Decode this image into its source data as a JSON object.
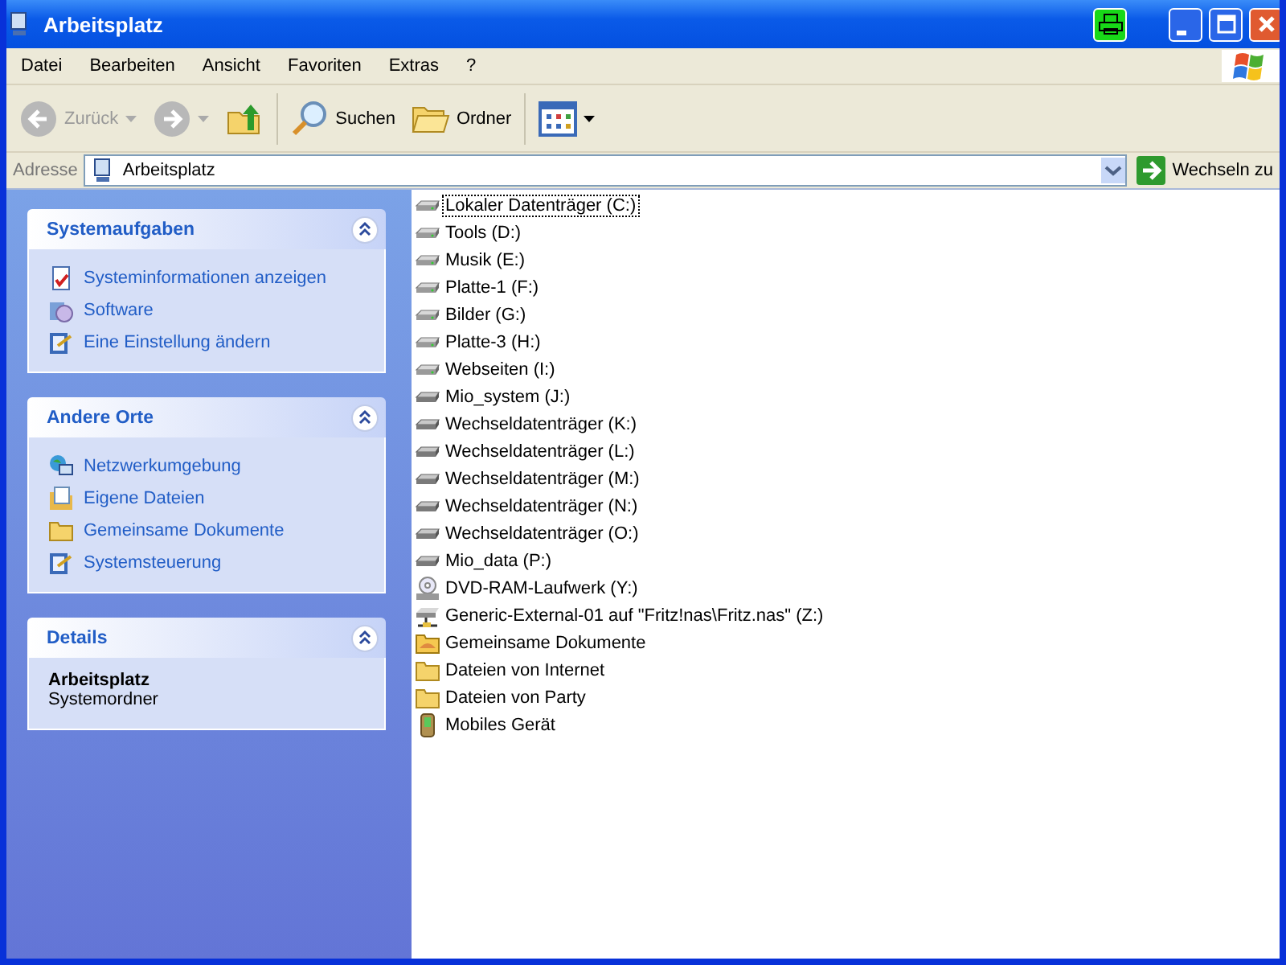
{
  "window": {
    "title": "Arbeitsplatz"
  },
  "menu": [
    "Datei",
    "Bearbeiten",
    "Ansicht",
    "Favoriten",
    "Extras",
    "?"
  ],
  "toolbar": [
    {
      "kind": "back",
      "label": "Zurück",
      "disabled": true
    },
    {
      "kind": "forward",
      "disabled": true
    },
    {
      "kind": "up"
    },
    {
      "kind": "separator"
    },
    {
      "kind": "search",
      "label": "Suchen"
    },
    {
      "kind": "folders",
      "label": "Ordner"
    },
    {
      "kind": "separator"
    },
    {
      "kind": "views"
    }
  ],
  "address": {
    "label": "Adresse",
    "value": "Arbeitsplatz",
    "go": "Wechseln zu"
  },
  "panels": [
    {
      "title": "Systemaufgaben",
      "expanded": true,
      "links": [
        {
          "kind": "info",
          "label": "Systeminformationen anzeigen"
        },
        {
          "kind": "software",
          "label": "Software"
        },
        {
          "kind": "control",
          "label": "Eine Einstellung ändern"
        }
      ]
    },
    {
      "title": "Andere Orte",
      "expanded": true,
      "links": [
        {
          "kind": "network",
          "label": "Netzwerkumgebung"
        },
        {
          "kind": "documents",
          "label": "Eigene Dateien"
        },
        {
          "kind": "folder",
          "label": "Gemeinsame Dokumente"
        },
        {
          "kind": "control",
          "label": "Systemsteuerung"
        }
      ]
    },
    {
      "title": "Details",
      "expanded": true,
      "name": "Arbeitsplatz",
      "type": "Systemordner"
    }
  ],
  "items": [
    {
      "kind": "drive",
      "label": "Lokaler Datenträger (C:)",
      "selected": true
    },
    {
      "kind": "drive",
      "label": "Tools (D:)",
      "selected": false
    },
    {
      "kind": "drive",
      "label": "Musik (E:)",
      "selected": false
    },
    {
      "kind": "drive",
      "label": "Platte-1 (F:)",
      "selected": false
    },
    {
      "kind": "drive",
      "label": "Bilder (G:)",
      "selected": false
    },
    {
      "kind": "drive",
      "label": "Platte-3 (H:)",
      "selected": false
    },
    {
      "kind": "drive",
      "label": "Webseiten (I:)",
      "selected": false
    },
    {
      "kind": "removable",
      "label": "Mio_system (J:)",
      "selected": false
    },
    {
      "kind": "removable",
      "label": "Wechseldatenträger (K:)",
      "selected": false
    },
    {
      "kind": "removable",
      "label": "Wechseldatenträger (L:)",
      "selected": false
    },
    {
      "kind": "removable",
      "label": "Wechseldatenträger (M:)",
      "selected": false
    },
    {
      "kind": "removable",
      "label": "Wechseldatenträger (N:)",
      "selected": false
    },
    {
      "kind": "removable",
      "label": "Wechseldatenträger (O:)",
      "selected": false
    },
    {
      "kind": "removable",
      "label": "Mio_data (P:)",
      "selected": false
    },
    {
      "kind": "dvd",
      "label": "DVD-RAM-Laufwerk (Y:)",
      "selected": false
    },
    {
      "kind": "network",
      "label": "Generic-External-01 auf \"Fritz!nas\\Fritz.nas\" (Z:)",
      "selected": false
    },
    {
      "kind": "shared",
      "label": "Gemeinsame Dokumente",
      "selected": false
    },
    {
      "kind": "folder",
      "label": "Dateien von Internet",
      "selected": false
    },
    {
      "kind": "folder",
      "label": "Dateien von Party",
      "selected": false
    },
    {
      "kind": "device",
      "label": "Mobiles Gerät",
      "selected": false
    }
  ]
}
